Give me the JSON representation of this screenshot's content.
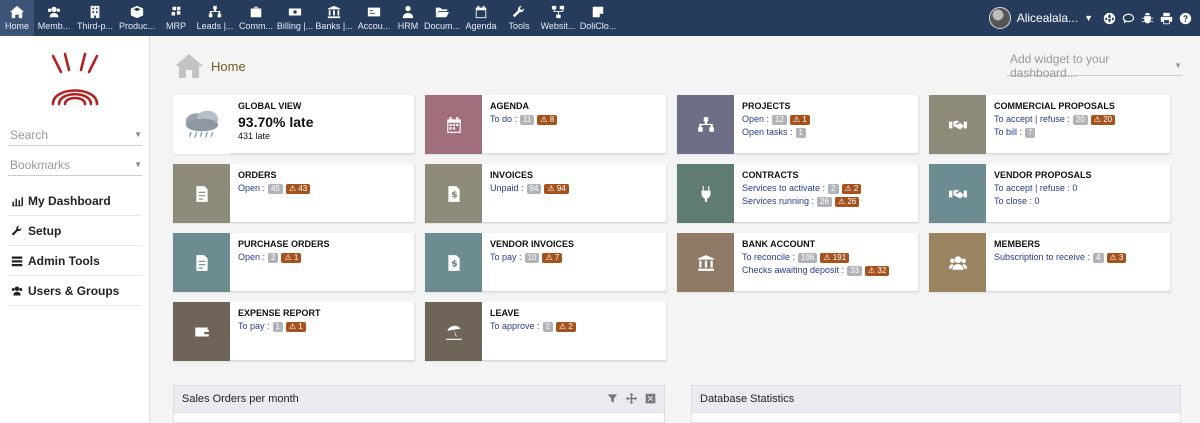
{
  "topmenu": [
    {
      "label": "Home",
      "icon": "home-icon",
      "active": true
    },
    {
      "label": "Memb...",
      "icon": "members-icon"
    },
    {
      "label": "Third-p...",
      "icon": "building-icon"
    },
    {
      "label": "Produc...",
      "icon": "cube-icon"
    },
    {
      "label": "MRP",
      "icon": "cubes-icon"
    },
    {
      "label": "Leads |...",
      "icon": "sitemap-icon"
    },
    {
      "label": "Comm...",
      "icon": "briefcase-icon"
    },
    {
      "label": "Billing |...",
      "icon": "money-icon"
    },
    {
      "label": "Banks |...",
      "icon": "bank-icon"
    },
    {
      "label": "Accou...",
      "icon": "dollar-card-icon"
    },
    {
      "label": "HRM",
      "icon": "user-tie-icon"
    },
    {
      "label": "Docum...",
      "icon": "folder-open-icon"
    },
    {
      "label": "Agenda",
      "icon": "calendar-icon"
    },
    {
      "label": "Tools",
      "icon": "wrench-icon"
    },
    {
      "label": "Websit...",
      "icon": "network-icon"
    },
    {
      "label": "DoliClo...",
      "icon": "note-icon"
    }
  ],
  "user": {
    "name": "Alicealala..."
  },
  "sidebar": {
    "search_placeholder": "Search",
    "bookmarks_placeholder": "Bookmarks",
    "items": [
      {
        "label": "My Dashboard",
        "icon": "chart-icon"
      },
      {
        "label": "Setup",
        "icon": "wrench-icon"
      },
      {
        "label": "Admin Tools",
        "icon": "list-icon"
      },
      {
        "label": "Users & Groups",
        "icon": "users-icon"
      }
    ]
  },
  "main": {
    "title": "Home",
    "add_widget_placeholder": "Add widget to your dashboard..."
  },
  "boxes": {
    "global": {
      "title": "GLOBAL VIEW",
      "percent": "93.70% late",
      "late": "431 late"
    },
    "agenda": {
      "title": "AGENDA",
      "l1": "To do :",
      "b1": "11",
      "w1": "8",
      "color": "#a16e7c"
    },
    "projects": {
      "title": "PROJECTS",
      "l1": "Open :",
      "b1": "12",
      "w1": "1",
      "l2": "Open tasks :",
      "b2": "1",
      "color": "#6c6f86"
    },
    "proposals": {
      "title": "COMMERCIAL PROPOSALS",
      "l1": "To accept | refuse :",
      "b1": "20",
      "w1": "20",
      "l2": "To bill :",
      "b2": "7",
      "color": "#8e8b7a"
    },
    "orders": {
      "title": "ORDERS",
      "l1": "Open :",
      "b1": "45",
      "w1": "43",
      "color": "#8e8b7a"
    },
    "invoices": {
      "title": "INVOICES",
      "l1": "Unpaid :",
      "b1": "94",
      "w1": "94",
      "color": "#8e8b7a"
    },
    "contracts": {
      "title": "CONTRACTS",
      "l1": "Services to activate :",
      "b1": "2",
      "w1": "2",
      "l2": "Services running :",
      "b2": "26",
      "w2": "26",
      "color": "#5e7c72"
    },
    "vendor_proposals": {
      "title": "VENDOR PROPOSALS",
      "l1": "To accept | refuse : 0",
      "l2": "To close : 0",
      "color": "#6c8c91"
    },
    "purchase_orders": {
      "title": "PURCHASE ORDERS",
      "l1": "Open :",
      "b1": "2",
      "w1": "1",
      "color": "#6c8c91"
    },
    "vendor_invoices": {
      "title": "VENDOR INVOICES",
      "l1": "To pay :",
      "b1": "10",
      "w1": "7",
      "color": "#6c8c91"
    },
    "bank": {
      "title": "BANK ACCOUNT",
      "l1": "To reconcile :",
      "b1": "196",
      "w1": "191",
      "l2": "Checks awaiting deposit :",
      "b2": "33",
      "w2": "32",
      "color": "#8f7a65"
    },
    "members": {
      "title": "MEMBERS",
      "l1": "Subscription to receive :",
      "b1": "4",
      "w1": "3",
      "color": "#9a8461"
    },
    "expense": {
      "title": "EXPENSE REPORT",
      "l1": "To pay :",
      "b1": "1",
      "w1": "1",
      "color": "#6e6457"
    },
    "leave": {
      "title": "LEAVE",
      "l1": "To approve :",
      "b1": "2",
      "w1": "2",
      "color": "#6e6457"
    }
  },
  "panels": {
    "sales": {
      "title": "Sales Orders per month"
    },
    "dbstats": {
      "title": "Database Statistics"
    }
  }
}
